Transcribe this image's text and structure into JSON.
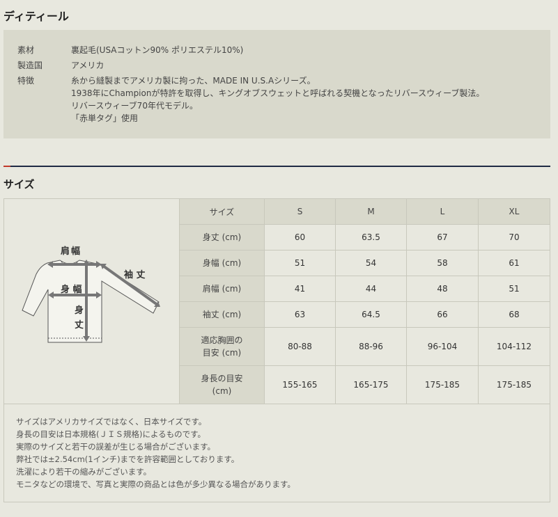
{
  "detail": {
    "title": "ディティール",
    "rows": [
      {
        "label": "素材",
        "lines": [
          "裏起毛(USAコットン90% ポリエステル10%)"
        ]
      },
      {
        "label": "製造国",
        "lines": [
          "アメリカ"
        ]
      },
      {
        "label": "特徴",
        "lines": [
          "糸から縫製までアメリカ製に拘った、MADE IN U.S.Aシリーズ。",
          "1938年にChampionが特許を取得し、キングオブスウェットと呼ばれる契機となったリバースウィーブ製法。",
          "リバースウィーブ70年代モデル。",
          "「赤単タグ」使用"
        ]
      }
    ]
  },
  "size": {
    "title": "サイズ",
    "diagram": {
      "shoulder": "肩幅",
      "chest": "身 幅",
      "sleeve": "袖 丈",
      "length_1": "身",
      "length_2": "丈"
    },
    "header": [
      "サイズ",
      "S",
      "M",
      "L",
      "XL"
    ],
    "rows": [
      {
        "label": [
          "身丈 (cm)"
        ],
        "values": [
          "60",
          "63.5",
          "67",
          "70"
        ]
      },
      {
        "label": [
          "身幅 (cm)"
        ],
        "values": [
          "51",
          "54",
          "58",
          "61"
        ]
      },
      {
        "label": [
          "肩幅 (cm)"
        ],
        "values": [
          "41",
          "44",
          "48",
          "51"
        ]
      },
      {
        "label": [
          "袖丈 (cm)"
        ],
        "values": [
          "63",
          "64.5",
          "66",
          "68"
        ]
      },
      {
        "label": [
          "適応胸囲の",
          "目安 (cm)"
        ],
        "values": [
          "80-88",
          "88-96",
          "96-104",
          "104-112"
        ]
      },
      {
        "label": [
          "身長の目安",
          "(cm)"
        ],
        "values": [
          "155-165",
          "165-175",
          "175-185",
          "175-185"
        ]
      }
    ]
  },
  "notes": [
    "サイズはアメリカサイズではなく、日本サイズです。",
    "身長の目安は日本規格(ＪＩＳ規格)によるものです。",
    "実際のサイズと若干の誤差が生じる場合がございます。",
    "弊社では±2.54cm(1インチ)までを許容範囲としております。",
    "洗濯により若干の縮みがございます。",
    "モニタなどの環境で、写真と実際の商品とは色が多少異なる場合があります。"
  ],
  "colors": {
    "background": "#e8e8df",
    "panel": "#d9d9cc",
    "divider_navy": "#1e2a44",
    "divider_red": "#c0392b",
    "arrow": "#777777"
  }
}
